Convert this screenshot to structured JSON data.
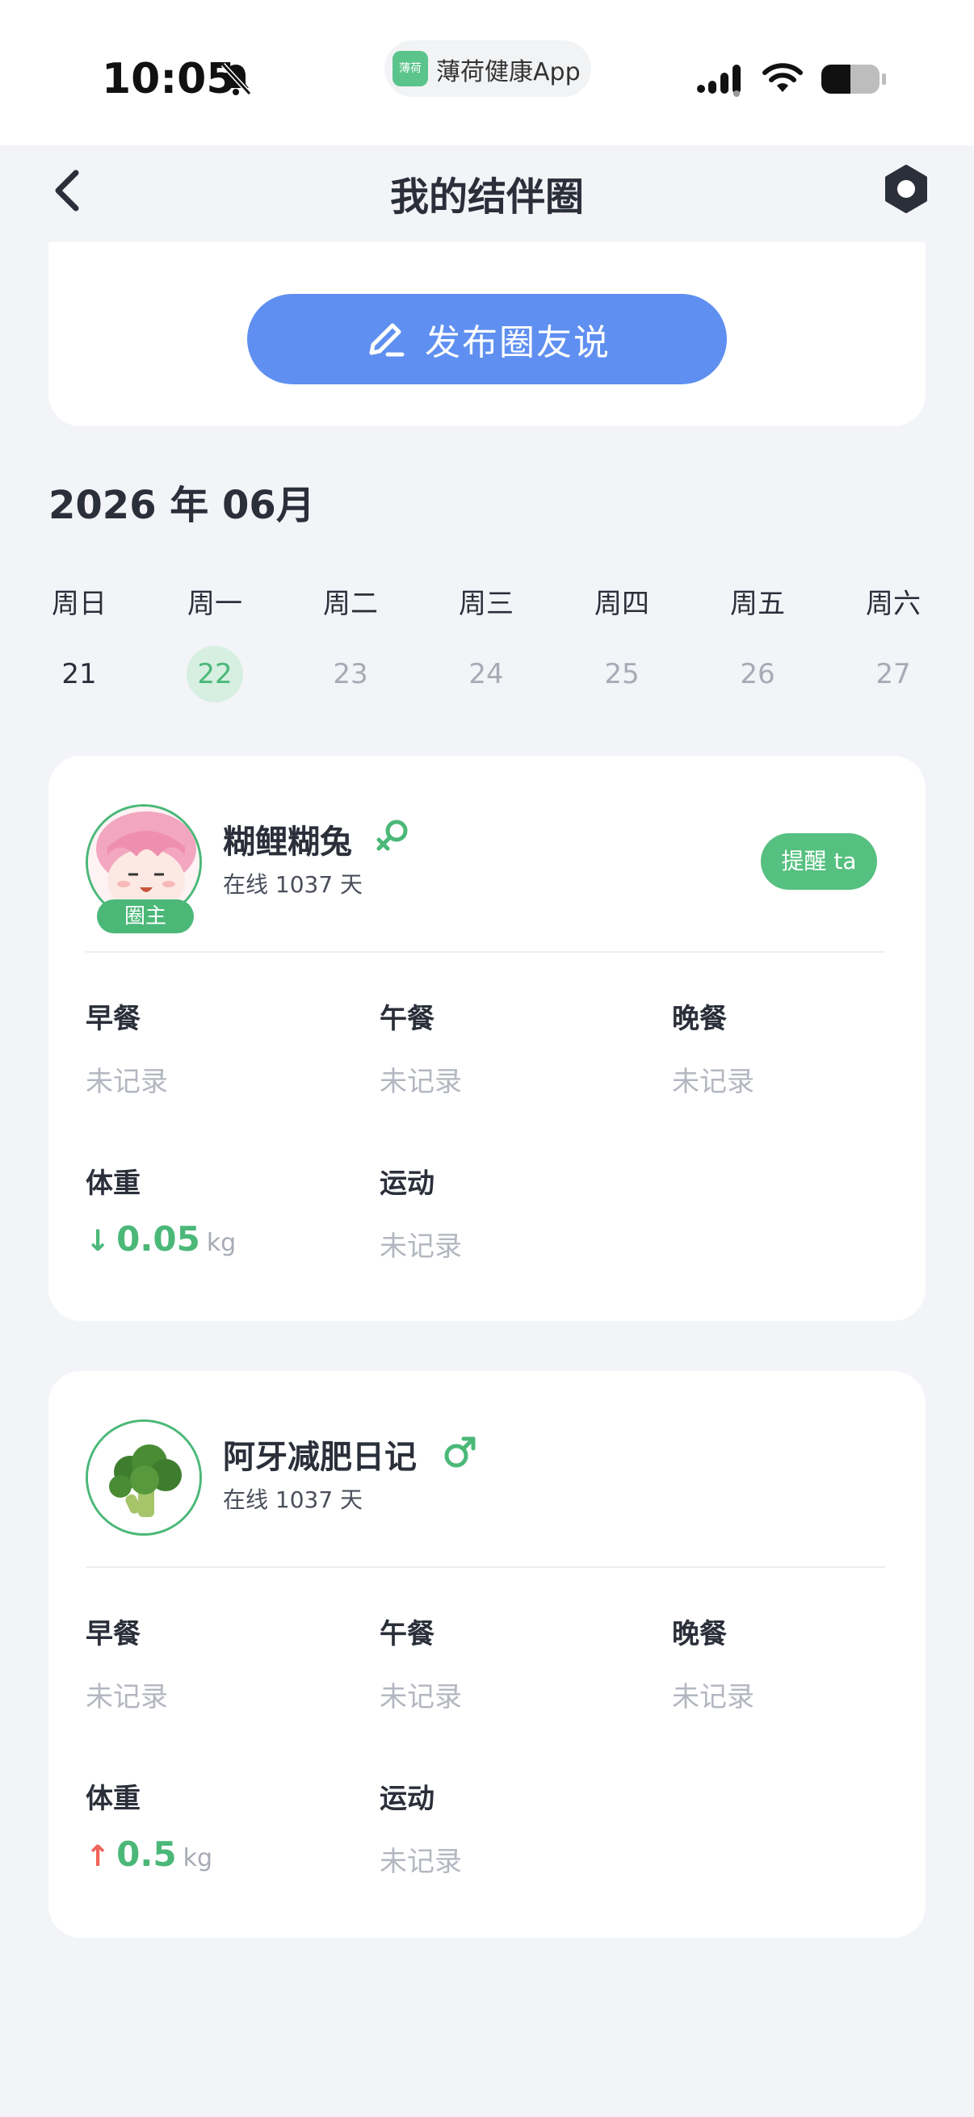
{
  "status_bar": {
    "time": "10:05",
    "app_icon_text": "薄荷",
    "app_name": "薄荷健康App"
  },
  "nav": {
    "title": "我的结伴圈"
  },
  "post": {
    "button_label": "发布圈友说"
  },
  "calendar": {
    "month": "2026 年 06月",
    "weekdays": [
      "周日",
      "周一",
      "周二",
      "周三",
      "周四",
      "周五",
      "周六"
    ],
    "dates": [
      "21",
      "22",
      "23",
      "24",
      "25",
      "26",
      "27"
    ],
    "selected_date": "22"
  },
  "members": [
    {
      "name": "糊鲤糊兔",
      "gender": "female",
      "online": "在线 1037 天",
      "badge": "圈主",
      "remind_label": "提醒 ta",
      "breakfast_label": "早餐",
      "breakfast_value": "未记录",
      "lunch_label": "午餐",
      "lunch_value": "未记录",
      "dinner_label": "晚餐",
      "dinner_value": "未记录",
      "weight_label": "体重",
      "weight_direction": "down",
      "weight_arrow": "↓",
      "weight_change": "0.05",
      "weight_unit": "kg",
      "exercise_label": "运动",
      "exercise_value": "未记录"
    },
    {
      "name": "阿牙减肥日记",
      "gender": "male",
      "online": "在线 1037 天",
      "breakfast_label": "早餐",
      "breakfast_value": "未记录",
      "lunch_label": "午餐",
      "lunch_value": "未记录",
      "dinner_label": "晚餐",
      "dinner_value": "未记录",
      "weight_label": "体重",
      "weight_direction": "up",
      "weight_arrow": "↑",
      "weight_change": "0.5",
      "weight_unit": "kg",
      "exercise_label": "运动",
      "exercise_value": "未记录"
    }
  ],
  "colors": {
    "accent_green": "#4bb878",
    "primary_blue": "#5f8ff0",
    "up_red": "#f0645a",
    "background": "#f3f4f8"
  }
}
